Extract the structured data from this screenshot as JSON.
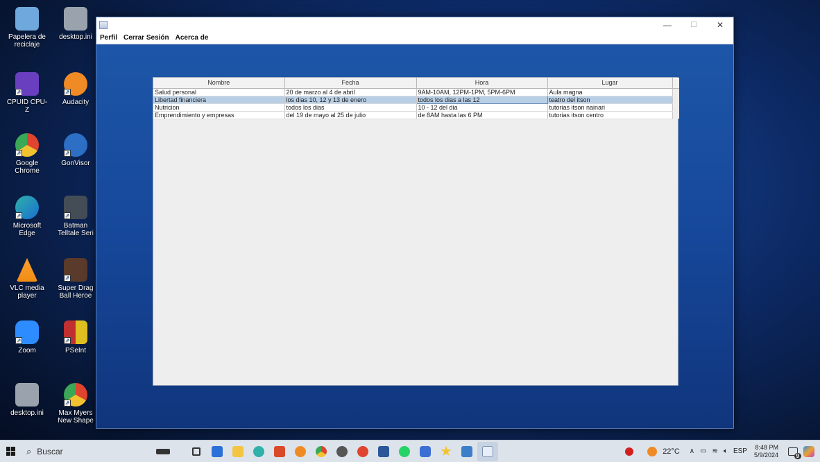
{
  "desktop": {
    "icons": [
      {
        "label": "Papelera de reciclaje",
        "color": "#6fa8dc"
      },
      {
        "label": "desktop.ini",
        "color": "#9aa3ad"
      },
      {
        "label": "CPUID CPU-Z",
        "color": "#6a3fbf"
      },
      {
        "label": "Audacity",
        "color": "#f08a24"
      },
      {
        "label": "Google Chrome",
        "color": "#e0442e"
      },
      {
        "label": "GonVisor",
        "color": "#2d6fc4"
      },
      {
        "label": "Microsoft Edge",
        "color": "#2fb0a8"
      },
      {
        "label": "Batman Telltale Seri",
        "color": "#444c56"
      },
      {
        "label": "VLC media player",
        "color": "#f28c13"
      },
      {
        "label": "Super Drag Ball Heroe",
        "color": "#5a3a2a"
      },
      {
        "label": "Zoom",
        "color": "#2d8cff"
      },
      {
        "label": "PSeInt",
        "color": "#e0c020"
      },
      {
        "label": "desktop.ini",
        "color": "#9aa3ad"
      },
      {
        "label": "Max Myers New Shape",
        "color": "#d04040"
      }
    ]
  },
  "window": {
    "menu": [
      "Perfil",
      "Cerrar Sesión",
      "Acerca de"
    ],
    "controls": {
      "minimize": "—",
      "maximize": "☐",
      "close": "✕"
    },
    "table": {
      "columns": [
        "Nombre",
        "Fecha",
        "Hora",
        "Lugar"
      ],
      "rows": [
        [
          "Salud personal",
          "20 de marzo al 4 de abril",
          "9AM-10AM, 12PM-1PM, 5PM-6PM",
          "Aula magna"
        ],
        [
          "Libertad financiera",
          "los dias 10, 12 y 13 de enero",
          "todos los dias a las 12",
          "teatro del itson"
        ],
        [
          "Nutricion",
          "todos los dias",
          "10 - 12 del dia",
          "tutorias itson nainari"
        ],
        [
          "Emprendimiento y empresas",
          "del 19 de mayo al 25 de julio",
          "de 8AM hasta las 6 PM",
          "tutorias itson centro"
        ]
      ],
      "selected_row": 1
    }
  },
  "taskbar": {
    "search_label": "Buscar",
    "weather": "22°C",
    "language": "ESP",
    "time": "8:48 PM",
    "date": "5/9/2024",
    "notification_count": "9"
  }
}
